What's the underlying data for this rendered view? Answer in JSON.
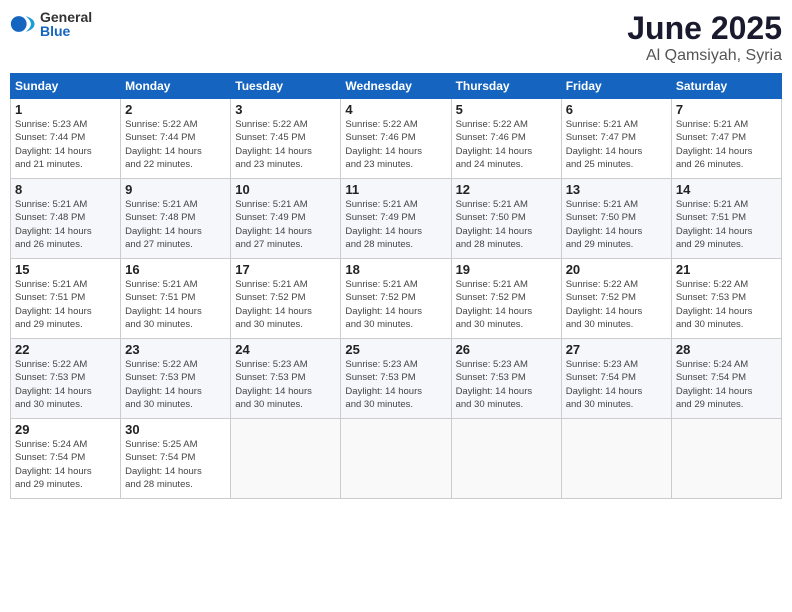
{
  "logo": {
    "general": "General",
    "blue": "Blue"
  },
  "title": {
    "month": "June 2025",
    "location": "Al Qamsiyah, Syria"
  },
  "days_of_week": [
    "Sunday",
    "Monday",
    "Tuesday",
    "Wednesday",
    "Thursday",
    "Friday",
    "Saturday"
  ],
  "weeks": [
    [
      {
        "day": "1",
        "sunrise": "5:23 AM",
        "sunset": "7:44 PM",
        "daylight": "14 hours and 21 minutes."
      },
      {
        "day": "2",
        "sunrise": "5:22 AM",
        "sunset": "7:44 PM",
        "daylight": "14 hours and 22 minutes."
      },
      {
        "day": "3",
        "sunrise": "5:22 AM",
        "sunset": "7:45 PM",
        "daylight": "14 hours and 23 minutes."
      },
      {
        "day": "4",
        "sunrise": "5:22 AM",
        "sunset": "7:46 PM",
        "daylight": "14 hours and 23 minutes."
      },
      {
        "day": "5",
        "sunrise": "5:22 AM",
        "sunset": "7:46 PM",
        "daylight": "14 hours and 24 minutes."
      },
      {
        "day": "6",
        "sunrise": "5:21 AM",
        "sunset": "7:47 PM",
        "daylight": "14 hours and 25 minutes."
      },
      {
        "day": "7",
        "sunrise": "5:21 AM",
        "sunset": "7:47 PM",
        "daylight": "14 hours and 26 minutes."
      }
    ],
    [
      {
        "day": "8",
        "sunrise": "5:21 AM",
        "sunset": "7:48 PM",
        "daylight": "14 hours and 26 minutes."
      },
      {
        "day": "9",
        "sunrise": "5:21 AM",
        "sunset": "7:48 PM",
        "daylight": "14 hours and 27 minutes."
      },
      {
        "day": "10",
        "sunrise": "5:21 AM",
        "sunset": "7:49 PM",
        "daylight": "14 hours and 27 minutes."
      },
      {
        "day": "11",
        "sunrise": "5:21 AM",
        "sunset": "7:49 PM",
        "daylight": "14 hours and 28 minutes."
      },
      {
        "day": "12",
        "sunrise": "5:21 AM",
        "sunset": "7:50 PM",
        "daylight": "14 hours and 28 minutes."
      },
      {
        "day": "13",
        "sunrise": "5:21 AM",
        "sunset": "7:50 PM",
        "daylight": "14 hours and 29 minutes."
      },
      {
        "day": "14",
        "sunrise": "5:21 AM",
        "sunset": "7:51 PM",
        "daylight": "14 hours and 29 minutes."
      }
    ],
    [
      {
        "day": "15",
        "sunrise": "5:21 AM",
        "sunset": "7:51 PM",
        "daylight": "14 hours and 29 minutes."
      },
      {
        "day": "16",
        "sunrise": "5:21 AM",
        "sunset": "7:51 PM",
        "daylight": "14 hours and 30 minutes."
      },
      {
        "day": "17",
        "sunrise": "5:21 AM",
        "sunset": "7:52 PM",
        "daylight": "14 hours and 30 minutes."
      },
      {
        "day": "18",
        "sunrise": "5:21 AM",
        "sunset": "7:52 PM",
        "daylight": "14 hours and 30 minutes."
      },
      {
        "day": "19",
        "sunrise": "5:21 AM",
        "sunset": "7:52 PM",
        "daylight": "14 hours and 30 minutes."
      },
      {
        "day": "20",
        "sunrise": "5:22 AM",
        "sunset": "7:52 PM",
        "daylight": "14 hours and 30 minutes."
      },
      {
        "day": "21",
        "sunrise": "5:22 AM",
        "sunset": "7:53 PM",
        "daylight": "14 hours and 30 minutes."
      }
    ],
    [
      {
        "day": "22",
        "sunrise": "5:22 AM",
        "sunset": "7:53 PM",
        "daylight": "14 hours and 30 minutes."
      },
      {
        "day": "23",
        "sunrise": "5:22 AM",
        "sunset": "7:53 PM",
        "daylight": "14 hours and 30 minutes."
      },
      {
        "day": "24",
        "sunrise": "5:23 AM",
        "sunset": "7:53 PM",
        "daylight": "14 hours and 30 minutes."
      },
      {
        "day": "25",
        "sunrise": "5:23 AM",
        "sunset": "7:53 PM",
        "daylight": "14 hours and 30 minutes."
      },
      {
        "day": "26",
        "sunrise": "5:23 AM",
        "sunset": "7:53 PM",
        "daylight": "14 hours and 30 minutes."
      },
      {
        "day": "27",
        "sunrise": "5:23 AM",
        "sunset": "7:54 PM",
        "daylight": "14 hours and 30 minutes."
      },
      {
        "day": "28",
        "sunrise": "5:24 AM",
        "sunset": "7:54 PM",
        "daylight": "14 hours and 29 minutes."
      }
    ],
    [
      {
        "day": "29",
        "sunrise": "5:24 AM",
        "sunset": "7:54 PM",
        "daylight": "14 hours and 29 minutes."
      },
      {
        "day": "30",
        "sunrise": "5:25 AM",
        "sunset": "7:54 PM",
        "daylight": "14 hours and 28 minutes."
      },
      null,
      null,
      null,
      null,
      null
    ]
  ],
  "labels": {
    "sunrise": "Sunrise:",
    "sunset": "Sunset:",
    "daylight": "Daylight:"
  }
}
